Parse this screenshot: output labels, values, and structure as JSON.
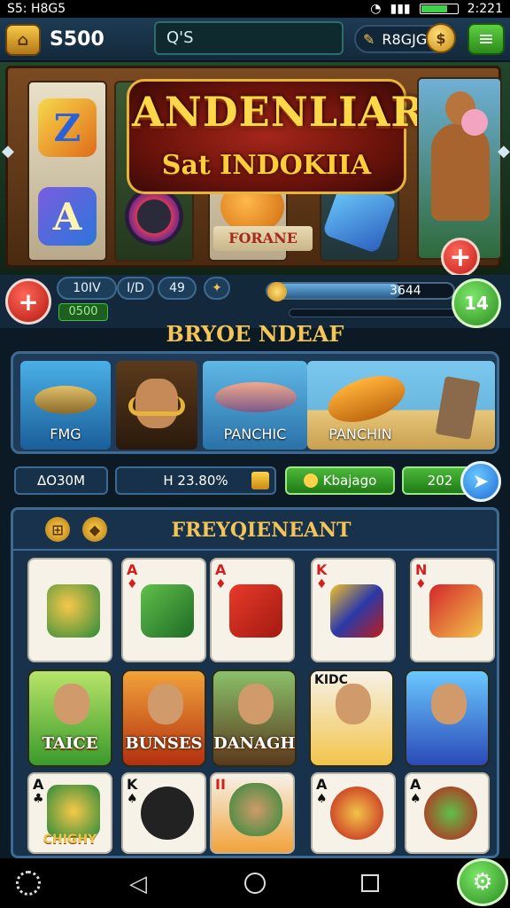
{
  "status": {
    "left": "S5: H8G5",
    "time": "2:221"
  },
  "topbar": {
    "balance": "S500",
    "search_value": "Q'S",
    "gems": "R8GJG"
  },
  "banner": {
    "title": "ANDENLIAR",
    "subtitle": "Sat INDOKIIA",
    "fortune": "FORANE"
  },
  "betrow": {
    "bet1": "10IV",
    "bet2": "I/D",
    "bet3": "49",
    "win": "0500",
    "progress_value": "3644",
    "progress_fraction": 0.72,
    "level": "14"
  },
  "section_title": "BRYOE NDEAF",
  "games": [
    {
      "label": "FMG"
    },
    {
      "label": ""
    },
    {
      "label": "PANCHIC"
    },
    {
      "label": "PANCHIN"
    }
  ],
  "buttons": {
    "b1": "ΔO30M",
    "b2": "H 23.80%",
    "b3": "Kbajago",
    "b4": "202"
  },
  "panel": {
    "title": "FREYQIENEANT"
  },
  "cards_row1": [
    {
      "rank": "",
      "suit": "",
      "color": "#d21f1f"
    },
    {
      "rank": "A",
      "suit": "♦",
      "color": "#d21f1f"
    },
    {
      "rank": "A",
      "suit": "♦",
      "color": "#d21f1f"
    },
    {
      "rank": "K",
      "suit": "♦",
      "color": "#d21f1f"
    },
    {
      "rank": "N",
      "suit": "♦",
      "color": "#d21f1f"
    }
  ],
  "tiles_row2": [
    {
      "label": "TAICE"
    },
    {
      "label": "BUNSES"
    },
    {
      "label": "DANAGH"
    },
    {
      "label": "KIDC"
    },
    {
      "label": ""
    }
  ],
  "cards_row3": [
    {
      "rank": "A",
      "suit": "♣",
      "label": "CHIGHY"
    },
    {
      "rank": "K",
      "suit": "♠",
      "label": ""
    },
    {
      "rank": "II",
      "suit": "",
      "label": ""
    },
    {
      "rank": "A",
      "suit": "♠",
      "label": ""
    },
    {
      "rank": "A",
      "suit": "♠",
      "label": ""
    }
  ],
  "colors": {
    "accent_gold": "#f4c457",
    "panel_bg": "#18324c",
    "green": "#2a8a1d",
    "red": "#c21d16"
  }
}
